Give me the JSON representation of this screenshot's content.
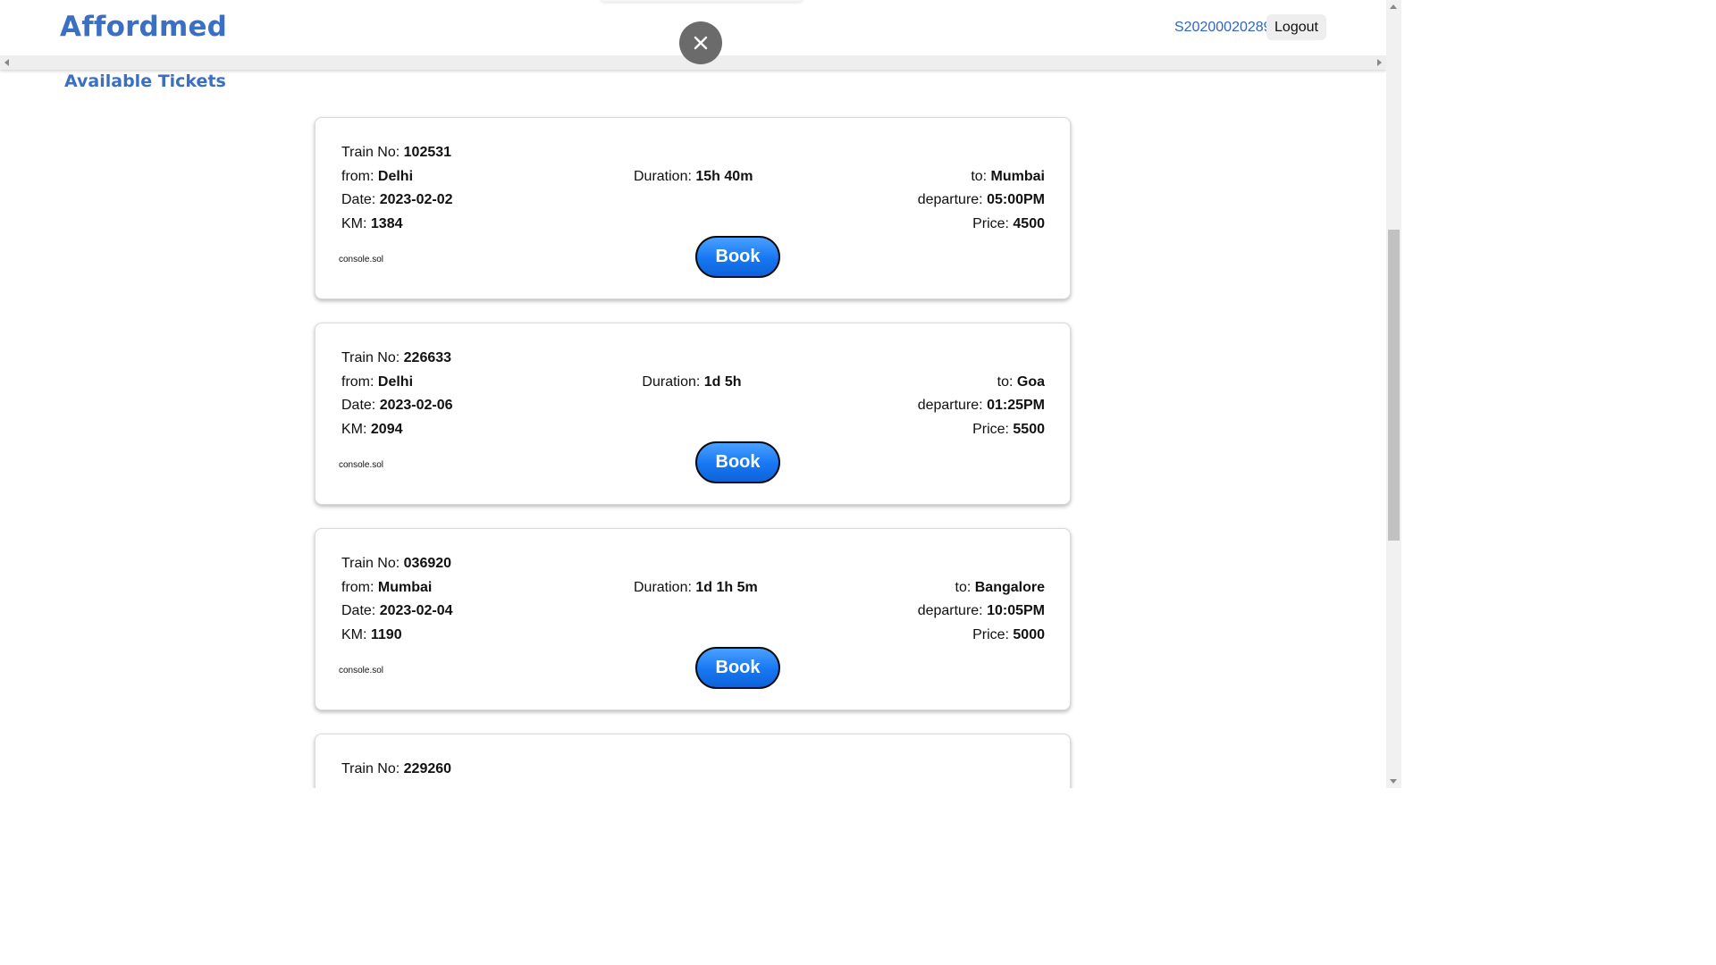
{
  "header": {
    "brand": "Affordmed",
    "user_id": "S20200020289",
    "logout_label": "Logout"
  },
  "section_title": "Available Tickets",
  "labels": {
    "train_no": "Train No: ",
    "from": "from: ",
    "date": "Date: ",
    "km": "KM: ",
    "duration": "Duration: ",
    "to": "to: ",
    "departure": "departure: ",
    "price": "Price: ",
    "console_note": "console.sol",
    "book": "Book"
  },
  "tickets": [
    {
      "train_no": "102531",
      "from": "Delhi",
      "date": "2023-02-02",
      "km": "1384",
      "duration": "15h 40m",
      "to": "Mumbai",
      "departure": "05:00PM",
      "price": "4500"
    },
    {
      "train_no": "226633",
      "from": "Delhi",
      "date": "2023-02-06",
      "km": "2094",
      "duration": "1d 5h",
      "to": "Goa",
      "departure": "01:25PM",
      "price": "5500"
    },
    {
      "train_no": "036920",
      "from": "Mumbai",
      "date": "2023-02-04",
      "km": "1190",
      "duration": "1d 1h 5m",
      "to": "Bangalore",
      "departure": "10:05PM",
      "price": "5000"
    },
    {
      "train_no": "229260"
    }
  ],
  "colors": {
    "brand": "#3a6fc4",
    "book_button": "#1677f2",
    "close_button": "#6b6b6b"
  },
  "icons": {
    "close": "close-icon"
  }
}
